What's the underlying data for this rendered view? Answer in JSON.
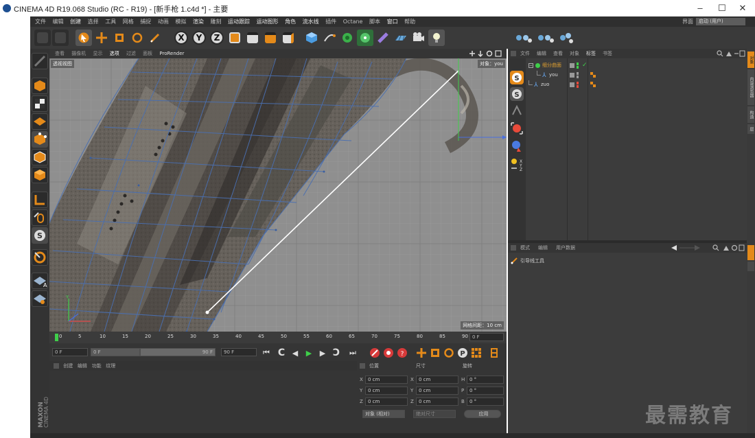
{
  "window": {
    "title": "CINEMA 4D R19.068 Studio (RC - R19) - [新手枪 1.c4d *] - 主要",
    "minimize": "–",
    "maximize": "☐",
    "close": "✕"
  },
  "menu": {
    "items": [
      "文件",
      "编辑",
      "创建",
      "选择",
      "工具",
      "网格",
      "捕捉",
      "动画",
      "模拟",
      "渲染",
      "雕刻",
      "运动跟踪",
      "运动图形",
      "角色",
      "流水线",
      "插件",
      "Octane",
      "脚本",
      "窗口",
      "帮助"
    ],
    "layout_label": "界面",
    "layout_value": "启动 (用户)"
  },
  "viewport": {
    "menu": [
      "查看",
      "摄像机",
      "显示",
      "选项",
      "过滤",
      "面板",
      "ProRender"
    ],
    "active_menu": "选项",
    "name": "透视视图",
    "object_label": "对象：you",
    "grid_spacing": "网格间距：10 cm"
  },
  "timeline": {
    "ticks": [
      "0",
      "5",
      "10",
      "15",
      "20",
      "25",
      "30",
      "35",
      "40",
      "45",
      "50",
      "55",
      "60",
      "65",
      "70",
      "75",
      "80",
      "85",
      "90"
    ],
    "current_frame": "0 F",
    "start": "0 F",
    "preview_start": "0 F",
    "preview_end": "90 F",
    "end": "90 F"
  },
  "materials": {
    "menu": [
      "创建",
      "编辑",
      "功能",
      "纹理"
    ]
  },
  "coords": {
    "headers": [
      "位置",
      "尺寸",
      "旋转"
    ],
    "rows": [
      {
        "axis": "X",
        "pos": "0 cm",
        "size_axis": "X",
        "size": "0 cm",
        "rot_axis": "H",
        "rot": "0 °"
      },
      {
        "axis": "Y",
        "pos": "0 cm",
        "size_axis": "Y",
        "size": "0 cm",
        "rot_axis": "P",
        "rot": "0 °"
      },
      {
        "axis": "Z",
        "pos": "0 cm",
        "size_axis": "Z",
        "size": "0 cm",
        "rot_axis": "B",
        "rot": "0 °"
      }
    ],
    "mode": "对象 (相对)",
    "size_mode": "绝对尺寸",
    "apply": "应用"
  },
  "object_manager": {
    "menu": [
      "文件",
      "编辑",
      "查看",
      "对象",
      "标签",
      "书签"
    ],
    "objects": [
      {
        "name": "细分曲面",
        "indent": 0,
        "color": "#e0a030"
      },
      {
        "name": "you",
        "indent": 1,
        "color": "#dddddd",
        "selected": true
      },
      {
        "name": "zuo",
        "indent": 0,
        "color": "#dddddd"
      }
    ]
  },
  "attribute_manager": {
    "menu": [
      "模式",
      "编辑",
      "用户数据"
    ],
    "tool": "引导线工具"
  },
  "side_tabs": [
    "对象",
    "内容浏览器",
    "构造",
    "层"
  ],
  "brand": "MAXON CINEMA 4D",
  "watermark": "最需教育",
  "colors": {
    "background": "#3a3a3a",
    "accent_orange": "#e48a1a",
    "viewport": "#8e8e8e",
    "mesh_lines": "#4a6fb0"
  }
}
